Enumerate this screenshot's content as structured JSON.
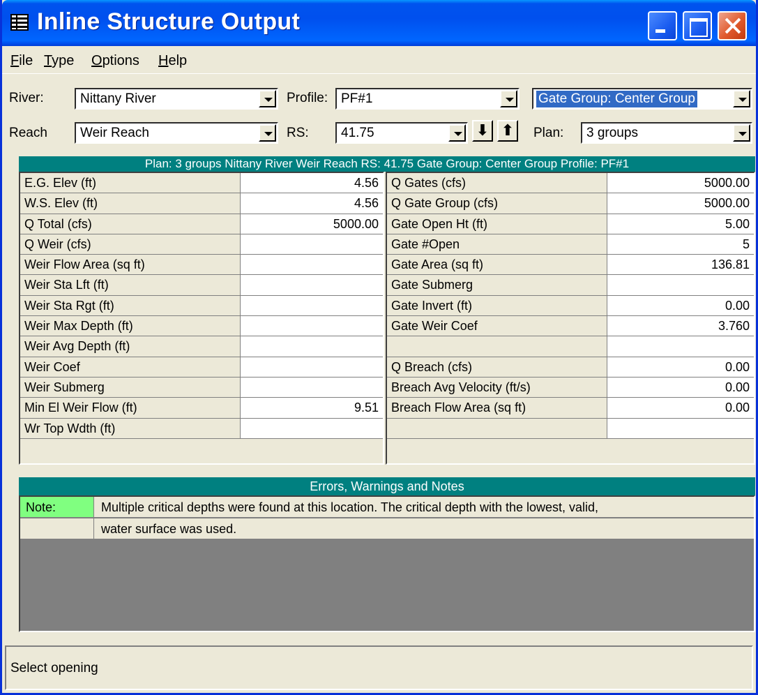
{
  "window": {
    "title": "Inline Structure Output"
  },
  "menu": [
    {
      "key": "F",
      "rest": "ile"
    },
    {
      "key": "T",
      "rest": "ype"
    },
    {
      "key": "O",
      "rest": "ptions"
    },
    {
      "key": "H",
      "rest": "elp"
    }
  ],
  "selectors": {
    "river_label": "River:",
    "river_value": "Nittany River",
    "profile_label": "Profile:",
    "profile_value": "PF#1",
    "gate_group_value": "Gate Group:  Center Group",
    "reach_label": "Reach",
    "reach_value": "Weir Reach",
    "rs_label": "RS:",
    "rs_value": "41.75",
    "plan_label": "Plan:",
    "plan_value": "3 groups"
  },
  "header": "Plan: 3 groups    Nittany River    Weir Reach  RS: 41.75   Gate Group:  Center Group    Profile: PF#1",
  "left_table": [
    {
      "label": "E.G. Elev (ft)",
      "value": "4.56"
    },
    {
      "label": "W.S. Elev (ft)",
      "value": "4.56"
    },
    {
      "label": "Q Total (cfs)",
      "value": "5000.00"
    },
    {
      "label": "Q Weir (cfs)",
      "value": ""
    },
    {
      "label": "Weir Flow Area (sq ft)",
      "value": ""
    },
    {
      "label": "Weir Sta Lft (ft)",
      "value": ""
    },
    {
      "label": "Weir Sta Rgt (ft)",
      "value": ""
    },
    {
      "label": "Weir Max Depth (ft)",
      "value": ""
    },
    {
      "label": "Weir Avg Depth (ft)",
      "value": ""
    },
    {
      "label": "Weir Coef",
      "value": ""
    },
    {
      "label": "Weir Submerg",
      "value": ""
    },
    {
      "label": "Min El Weir Flow (ft)",
      "value": "9.51"
    },
    {
      "label": "Wr Top Wdth (ft)",
      "value": ""
    }
  ],
  "right_table": [
    {
      "label": "Q Gates (cfs)",
      "value": "5000.00"
    },
    {
      "label": "Q Gate Group (cfs)",
      "value": "5000.00"
    },
    {
      "label": "Gate Open Ht (ft)",
      "value": "5.00"
    },
    {
      "label": "Gate #Open",
      "value": "5"
    },
    {
      "label": "Gate Area (sq ft)",
      "value": "136.81"
    },
    {
      "label": "Gate Submerg",
      "value": ""
    },
    {
      "label": "Gate Invert (ft)",
      "value": "0.00"
    },
    {
      "label": "Gate Weir Coef",
      "value": "3.760"
    },
    {
      "label": "",
      "value": ""
    },
    {
      "label": "Q Breach (cfs)",
      "value": "0.00"
    },
    {
      "label": "Breach Avg Velocity (ft/s)",
      "value": "0.00"
    },
    {
      "label": "Breach Flow Area (sq ft)",
      "value": "0.00"
    },
    {
      "label": "",
      "value": ""
    }
  ],
  "notes": {
    "title": "Errors, Warnings and Notes",
    "tag": "Note:",
    "tag_color": "#80ff80",
    "line1": "Multiple critical depths were found at this location.  The critical depth with the lowest, valid,",
    "line2": "water surface was used."
  },
  "status": "Select opening"
}
